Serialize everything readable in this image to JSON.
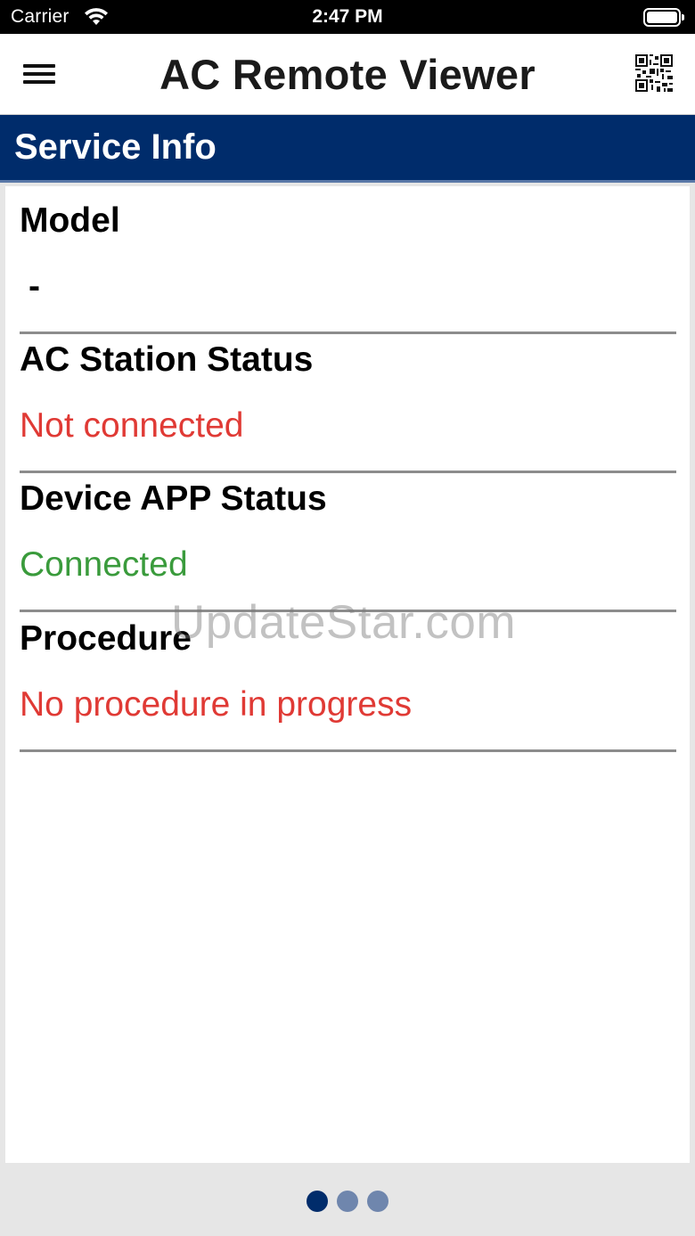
{
  "status_bar": {
    "carrier": "Carrier",
    "time": "2:47 PM",
    "icons": [
      "wifi-icon",
      "battery-icon"
    ]
  },
  "nav": {
    "title": "AC Remote Viewer",
    "menu_icon": "hamburger-menu-icon",
    "qr_icon": "qr-code-icon"
  },
  "section": {
    "title": "Service Info"
  },
  "rows": [
    {
      "label": "Model",
      "value": "-"
    },
    {
      "label": "AC Station Status",
      "value": "Not connected",
      "value_color": "#e03a35"
    },
    {
      "label": "Device APP Status",
      "value": "Connected",
      "value_color": "#3a9b3c"
    },
    {
      "label": "Procedure",
      "value": "No procedure in progress",
      "value_color": "#e03a35"
    }
  ],
  "watermark": "UpdateStar.com",
  "pager": {
    "count": 3,
    "active_index": 0
  },
  "colors": {
    "header_blue": "#002c6b",
    "pager_inactive": "#6f86ad",
    "status_red": "#e03a35",
    "status_green": "#3a9b3c"
  }
}
